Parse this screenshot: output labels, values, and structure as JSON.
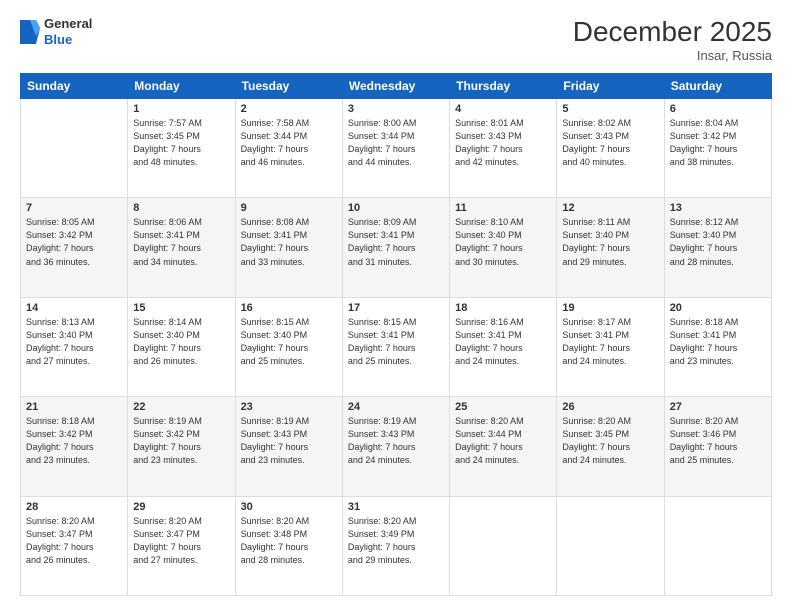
{
  "header": {
    "logo": {
      "general": "General",
      "blue": "Blue"
    },
    "title": "December 2025",
    "location": "Insar, Russia"
  },
  "days_of_week": [
    "Sunday",
    "Monday",
    "Tuesday",
    "Wednesday",
    "Thursday",
    "Friday",
    "Saturday"
  ],
  "weeks": [
    [
      {
        "day": "",
        "info": ""
      },
      {
        "day": "1",
        "info": "Sunrise: 7:57 AM\nSunset: 3:45 PM\nDaylight: 7 hours\nand 48 minutes."
      },
      {
        "day": "2",
        "info": "Sunrise: 7:58 AM\nSunset: 3:44 PM\nDaylight: 7 hours\nand 46 minutes."
      },
      {
        "day": "3",
        "info": "Sunrise: 8:00 AM\nSunset: 3:44 PM\nDaylight: 7 hours\nand 44 minutes."
      },
      {
        "day": "4",
        "info": "Sunrise: 8:01 AM\nSunset: 3:43 PM\nDaylight: 7 hours\nand 42 minutes."
      },
      {
        "day": "5",
        "info": "Sunrise: 8:02 AM\nSunset: 3:43 PM\nDaylight: 7 hours\nand 40 minutes."
      },
      {
        "day": "6",
        "info": "Sunrise: 8:04 AM\nSunset: 3:42 PM\nDaylight: 7 hours\nand 38 minutes."
      }
    ],
    [
      {
        "day": "7",
        "info": "Sunrise: 8:05 AM\nSunset: 3:42 PM\nDaylight: 7 hours\nand 36 minutes."
      },
      {
        "day": "8",
        "info": "Sunrise: 8:06 AM\nSunset: 3:41 PM\nDaylight: 7 hours\nand 34 minutes."
      },
      {
        "day": "9",
        "info": "Sunrise: 8:08 AM\nSunset: 3:41 PM\nDaylight: 7 hours\nand 33 minutes."
      },
      {
        "day": "10",
        "info": "Sunrise: 8:09 AM\nSunset: 3:41 PM\nDaylight: 7 hours\nand 31 minutes."
      },
      {
        "day": "11",
        "info": "Sunrise: 8:10 AM\nSunset: 3:40 PM\nDaylight: 7 hours\nand 30 minutes."
      },
      {
        "day": "12",
        "info": "Sunrise: 8:11 AM\nSunset: 3:40 PM\nDaylight: 7 hours\nand 29 minutes."
      },
      {
        "day": "13",
        "info": "Sunrise: 8:12 AM\nSunset: 3:40 PM\nDaylight: 7 hours\nand 28 minutes."
      }
    ],
    [
      {
        "day": "14",
        "info": "Sunrise: 8:13 AM\nSunset: 3:40 PM\nDaylight: 7 hours\nand 27 minutes."
      },
      {
        "day": "15",
        "info": "Sunrise: 8:14 AM\nSunset: 3:40 PM\nDaylight: 7 hours\nand 26 minutes."
      },
      {
        "day": "16",
        "info": "Sunrise: 8:15 AM\nSunset: 3:40 PM\nDaylight: 7 hours\nand 25 minutes."
      },
      {
        "day": "17",
        "info": "Sunrise: 8:15 AM\nSunset: 3:41 PM\nDaylight: 7 hours\nand 25 minutes."
      },
      {
        "day": "18",
        "info": "Sunrise: 8:16 AM\nSunset: 3:41 PM\nDaylight: 7 hours\nand 24 minutes."
      },
      {
        "day": "19",
        "info": "Sunrise: 8:17 AM\nSunset: 3:41 PM\nDaylight: 7 hours\nand 24 minutes."
      },
      {
        "day": "20",
        "info": "Sunrise: 8:18 AM\nSunset: 3:41 PM\nDaylight: 7 hours\nand 23 minutes."
      }
    ],
    [
      {
        "day": "21",
        "info": "Sunrise: 8:18 AM\nSunset: 3:42 PM\nDaylight: 7 hours\nand 23 minutes."
      },
      {
        "day": "22",
        "info": "Sunrise: 8:19 AM\nSunset: 3:42 PM\nDaylight: 7 hours\nand 23 minutes."
      },
      {
        "day": "23",
        "info": "Sunrise: 8:19 AM\nSunset: 3:43 PM\nDaylight: 7 hours\nand 23 minutes."
      },
      {
        "day": "24",
        "info": "Sunrise: 8:19 AM\nSunset: 3:43 PM\nDaylight: 7 hours\nand 24 minutes."
      },
      {
        "day": "25",
        "info": "Sunrise: 8:20 AM\nSunset: 3:44 PM\nDaylight: 7 hours\nand 24 minutes."
      },
      {
        "day": "26",
        "info": "Sunrise: 8:20 AM\nSunset: 3:45 PM\nDaylight: 7 hours\nand 24 minutes."
      },
      {
        "day": "27",
        "info": "Sunrise: 8:20 AM\nSunset: 3:46 PM\nDaylight: 7 hours\nand 25 minutes."
      }
    ],
    [
      {
        "day": "28",
        "info": "Sunrise: 8:20 AM\nSunset: 3:47 PM\nDaylight: 7 hours\nand 26 minutes."
      },
      {
        "day": "29",
        "info": "Sunrise: 8:20 AM\nSunset: 3:47 PM\nDaylight: 7 hours\nand 27 minutes."
      },
      {
        "day": "30",
        "info": "Sunrise: 8:20 AM\nSunset: 3:48 PM\nDaylight: 7 hours\nand 28 minutes."
      },
      {
        "day": "31",
        "info": "Sunrise: 8:20 AM\nSunset: 3:49 PM\nDaylight: 7 hours\nand 29 minutes."
      },
      {
        "day": "",
        "info": ""
      },
      {
        "day": "",
        "info": ""
      },
      {
        "day": "",
        "info": ""
      }
    ]
  ]
}
